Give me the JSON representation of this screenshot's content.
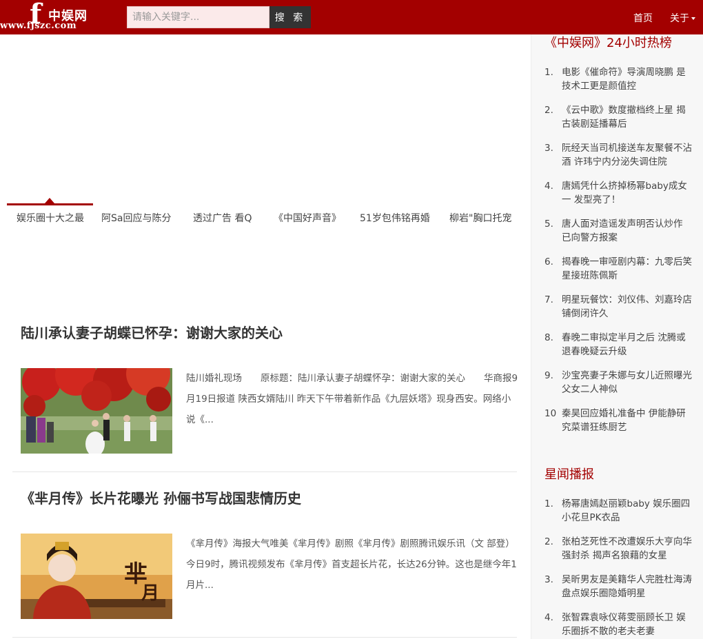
{
  "header": {
    "logo_letter": "f",
    "logo_name": "中娱网",
    "logo_url": "www.fjszc.com",
    "search_placeholder": "请输入关键字...",
    "search_button": "搜 索",
    "nav_home": "首页",
    "nav_about": "关于"
  },
  "slider": {
    "tabs": [
      "娱乐圈十大之最",
      "阿Sa回应与陈分",
      "透过广告 看Q",
      "《中国好声音》",
      "51岁包伟铭再婚",
      "柳岩\"胸口托宠"
    ]
  },
  "articles": [
    {
      "title": "陆川承认妻子胡蝶已怀孕：谢谢大家的关心",
      "summary": "陆川婚礼现场　　原标题：陆川承认妻子胡蝶怀孕：谢谢大家的关心　　华商报9月19日报道 陕西女婿陆川 昨天下午带着新作品《九层妖塔》现身西安。网络小说《..."
    },
    {
      "title": "《芈月传》长片花曝光 孙俪书写战国悲情历史",
      "summary": "《芈月传》海报大气唯美《芈月传》剧照《芈月传》剧照腾讯娱乐讯（文 部登）今日9时，腾讯视频发布《芈月传》首支超长片花，长达26分钟。这也是继今年1月片..."
    }
  ],
  "sidebar": {
    "hot_title": "《中娱网》24小时热榜",
    "hot_items": [
      {
        "num": "1.",
        "text": "电影《催命符》导演周晓鹏 是技术工更是颜值控"
      },
      {
        "num": "2.",
        "text": "《云中歌》数度撤档终上星 揭古装剧延播幕后"
      },
      {
        "num": "3.",
        "text": "阮经天当司机接送车友聚餐不沾酒 许玮宁内分泌失调住院"
      },
      {
        "num": "4.",
        "text": "唐嫣凭什么挤掉杨幂baby成女一 发型亮了！"
      },
      {
        "num": "5.",
        "text": "唐人面对造谣发声明否认炒作 已向警方报案"
      },
      {
        "num": "6.",
        "text": "揭春晚一审哑剧内幕：九零后笑星接班陈佩斯"
      },
      {
        "num": "7.",
        "text": "明星玩餐饮：刘仪伟、刘嘉玲店铺倒闭许久"
      },
      {
        "num": "8.",
        "text": "春晚二审拟定半月之后 沈腾或退春晚疑云升级"
      },
      {
        "num": "9.",
        "text": "沙宝亮妻子朱娜与女儿近照曝光 父女二人神似"
      },
      {
        "num": "10",
        "text": "秦昊回应婚礼准备中 伊能静研究菜谱狂练厨艺"
      }
    ],
    "news_title": "星闻播报",
    "news_items": [
      {
        "num": "1.",
        "text": "杨幂唐嫣赵丽颖baby 娱乐圈四小花旦PK衣品"
      },
      {
        "num": "2.",
        "text": "张柏芝死性不改遭娱乐大亨向华强封杀 揭声名狼藉的女星"
      },
      {
        "num": "3.",
        "text": "吴昕男友是美籍华人完胜杜海涛 盘点娱乐圈隐婚明星"
      },
      {
        "num": "4.",
        "text": "张智霖袁咏仪蒋雯丽顾长卫 娱乐圈拆不散的老夫老妻"
      }
    ]
  },
  "colors": {
    "brand": "#a30000",
    "search_button_bg": "#333333"
  }
}
